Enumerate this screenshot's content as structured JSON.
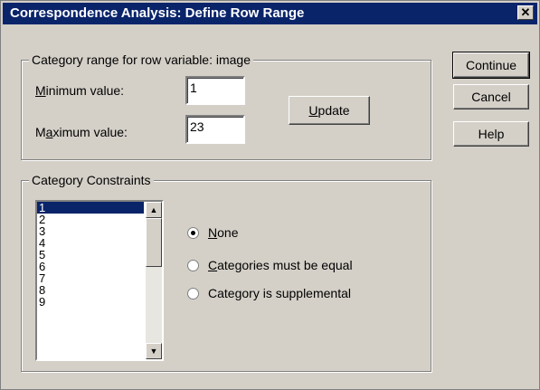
{
  "window": {
    "title": "Correspondence Analysis: Define Row Range",
    "close_glyph": "✕"
  },
  "row_range": {
    "group_label": "Category range for row variable: image",
    "min_label_accel": "M",
    "min_label_rest": "inimum value:",
    "min_value": "1",
    "max_label_pre": "M",
    "max_label_accel": "a",
    "max_label_rest": "ximum value:",
    "max_value": "23",
    "update_accel": "U",
    "update_rest": "pdate"
  },
  "buttons": {
    "continue": "Continue",
    "cancel": "Cancel",
    "help": "Help"
  },
  "constraints": {
    "group_label": "Category Constraints",
    "list_items": [
      "1",
      "2",
      "3",
      "4",
      "5",
      "6",
      "7",
      "8",
      "9"
    ],
    "selected_index": 0,
    "scroll_up_glyph": "▲",
    "scroll_down_glyph": "▼",
    "options": [
      {
        "accel": "N",
        "rest": "one",
        "pre": "",
        "checked": true
      },
      {
        "accel": "C",
        "rest": "ategories must be equal",
        "pre": "",
        "checked": false
      },
      {
        "pre": "Cate",
        "accel": "g",
        "rest": "ory is supplemental",
        "checked": false
      }
    ]
  }
}
